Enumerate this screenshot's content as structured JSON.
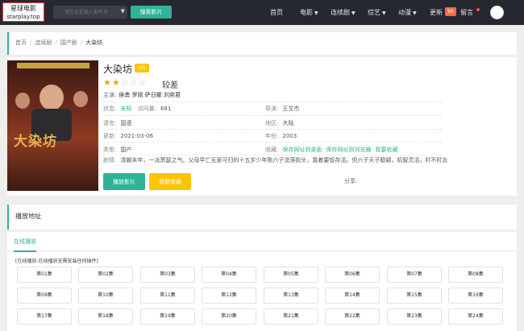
{
  "site": {
    "name": "星球电影",
    "domain": "starplay.top"
  },
  "search": {
    "placeholder": "请在此处输入影片关",
    "button": "搜索影片"
  },
  "nav": {
    "items": [
      {
        "label": "首页",
        "dropdown": false
      },
      {
        "label": "电影",
        "dropdown": true
      },
      {
        "label": "连续剧",
        "dropdown": true
      },
      {
        "label": "综艺",
        "dropdown": true
      },
      {
        "label": "动漫",
        "dropdown": true
      }
    ],
    "update_label": "更新",
    "update_count": "56",
    "message_label": "留言"
  },
  "breadcrumb": {
    "items": [
      "首页",
      "连续剧",
      "国产剧"
    ],
    "current": "大染坊"
  },
  "detail": {
    "title": "大染坊",
    "quality": "HD",
    "stars_filled": 2,
    "stars_total": 5,
    "rating_text": "较差",
    "cast_label": "主演:",
    "cast": "侯勇  罗刚  萨日娜  刘奕君",
    "status_label": "状态:",
    "status": "未知",
    "views_label": "访问量:",
    "views": "681",
    "director_label": "导演:",
    "director": "王文杰",
    "language_label": "语言:",
    "language": "国语",
    "region_label": "地区:",
    "region": "大陆",
    "updated_label": "更新:",
    "updated": "2021-03-06",
    "year_label": "年份:",
    "year": "2003",
    "type_label": "类型:",
    "type": "国产",
    "collect_label": "收藏:",
    "collect_links": [
      "保存网址到桌面",
      "保存网址到浏览器",
      "我要收藏"
    ],
    "synopsis_label": "剧情:",
    "synopsis": "清朝末年，一派萧瑟之气。父母早亡无家可归的十五岁少年陈六子流落街头，靠着要饭存活。但六子天子聪颖，机智灵活，时不时去",
    "play_button": "播放影片",
    "fav_button": "我要收藏",
    "share_label": "分享:"
  },
  "poster": {
    "title_text": "大染坊"
  },
  "play": {
    "section_title": "播放地址",
    "tab": "在线播放",
    "note": "[在线播放-在线播放无需安装任何插件]",
    "episodes": [
      "第01集",
      "第02集",
      "第03集",
      "第04集",
      "第05集",
      "第06集",
      "第07集",
      "第08集",
      "第09集",
      "第10集",
      "第11集",
      "第12集",
      "第13集",
      "第14集",
      "第15集",
      "第16集",
      "第17集",
      "第18集",
      "第19集",
      "第20集",
      "第21集",
      "第22集",
      "第23集",
      "第24集"
    ]
  },
  "colors": {
    "accent": "#2eb398",
    "gold": "#ffc300",
    "topbar": "#252830",
    "badge": "#ff6a3d"
  }
}
